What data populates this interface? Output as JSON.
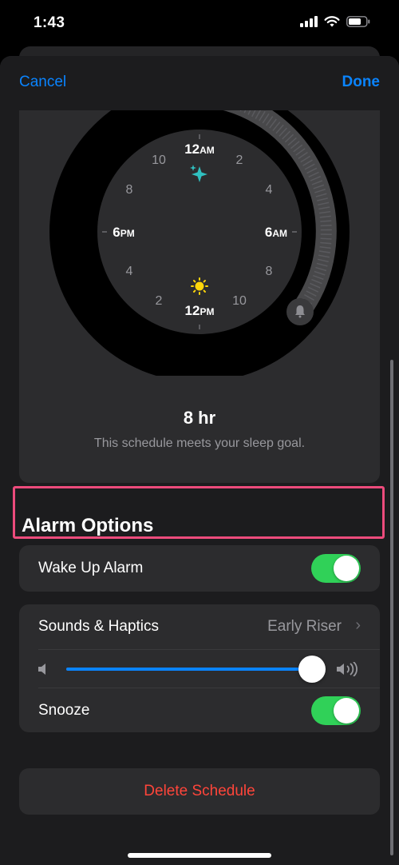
{
  "status_bar": {
    "time": "1:43"
  },
  "nav": {
    "cancel_label": "Cancel",
    "done_label": "Done"
  },
  "clock": {
    "labels": {
      "top_num": "12",
      "top_suffix": "AM",
      "right_num": "6",
      "right_suffix": "AM",
      "bottom_num": "12",
      "bottom_suffix": "PM",
      "left_num": "6",
      "left_suffix": "PM",
      "h2a": "2",
      "h4a": "4",
      "h8a": "8",
      "h10a": "10",
      "h2p": "2",
      "h4p": "4",
      "h8p": "8",
      "h10p": "10"
    },
    "bedtime_icon": "sparkle-icon",
    "wake_icon": "sun-icon",
    "alarm_icon": "bell-icon",
    "duration": "8 hr",
    "goal_text": "This schedule meets your sleep goal."
  },
  "alarm_options": {
    "title": "Alarm Options",
    "wake_up_alarm_label": "Wake Up Alarm",
    "wake_up_alarm_on": true,
    "sounds_label": "Sounds & Haptics",
    "sounds_value": "Early Riser",
    "volume_level": 0.95,
    "snooze_label": "Snooze",
    "snooze_on": true
  },
  "delete_label": "Delete Schedule",
  "colors": {
    "accent": "#0a84ff",
    "toggle_on": "#30d158",
    "destructive": "#ff453a",
    "highlight": "#ec4b7c",
    "bedtime": "#30c0c0",
    "wake": "#ffd60a"
  }
}
